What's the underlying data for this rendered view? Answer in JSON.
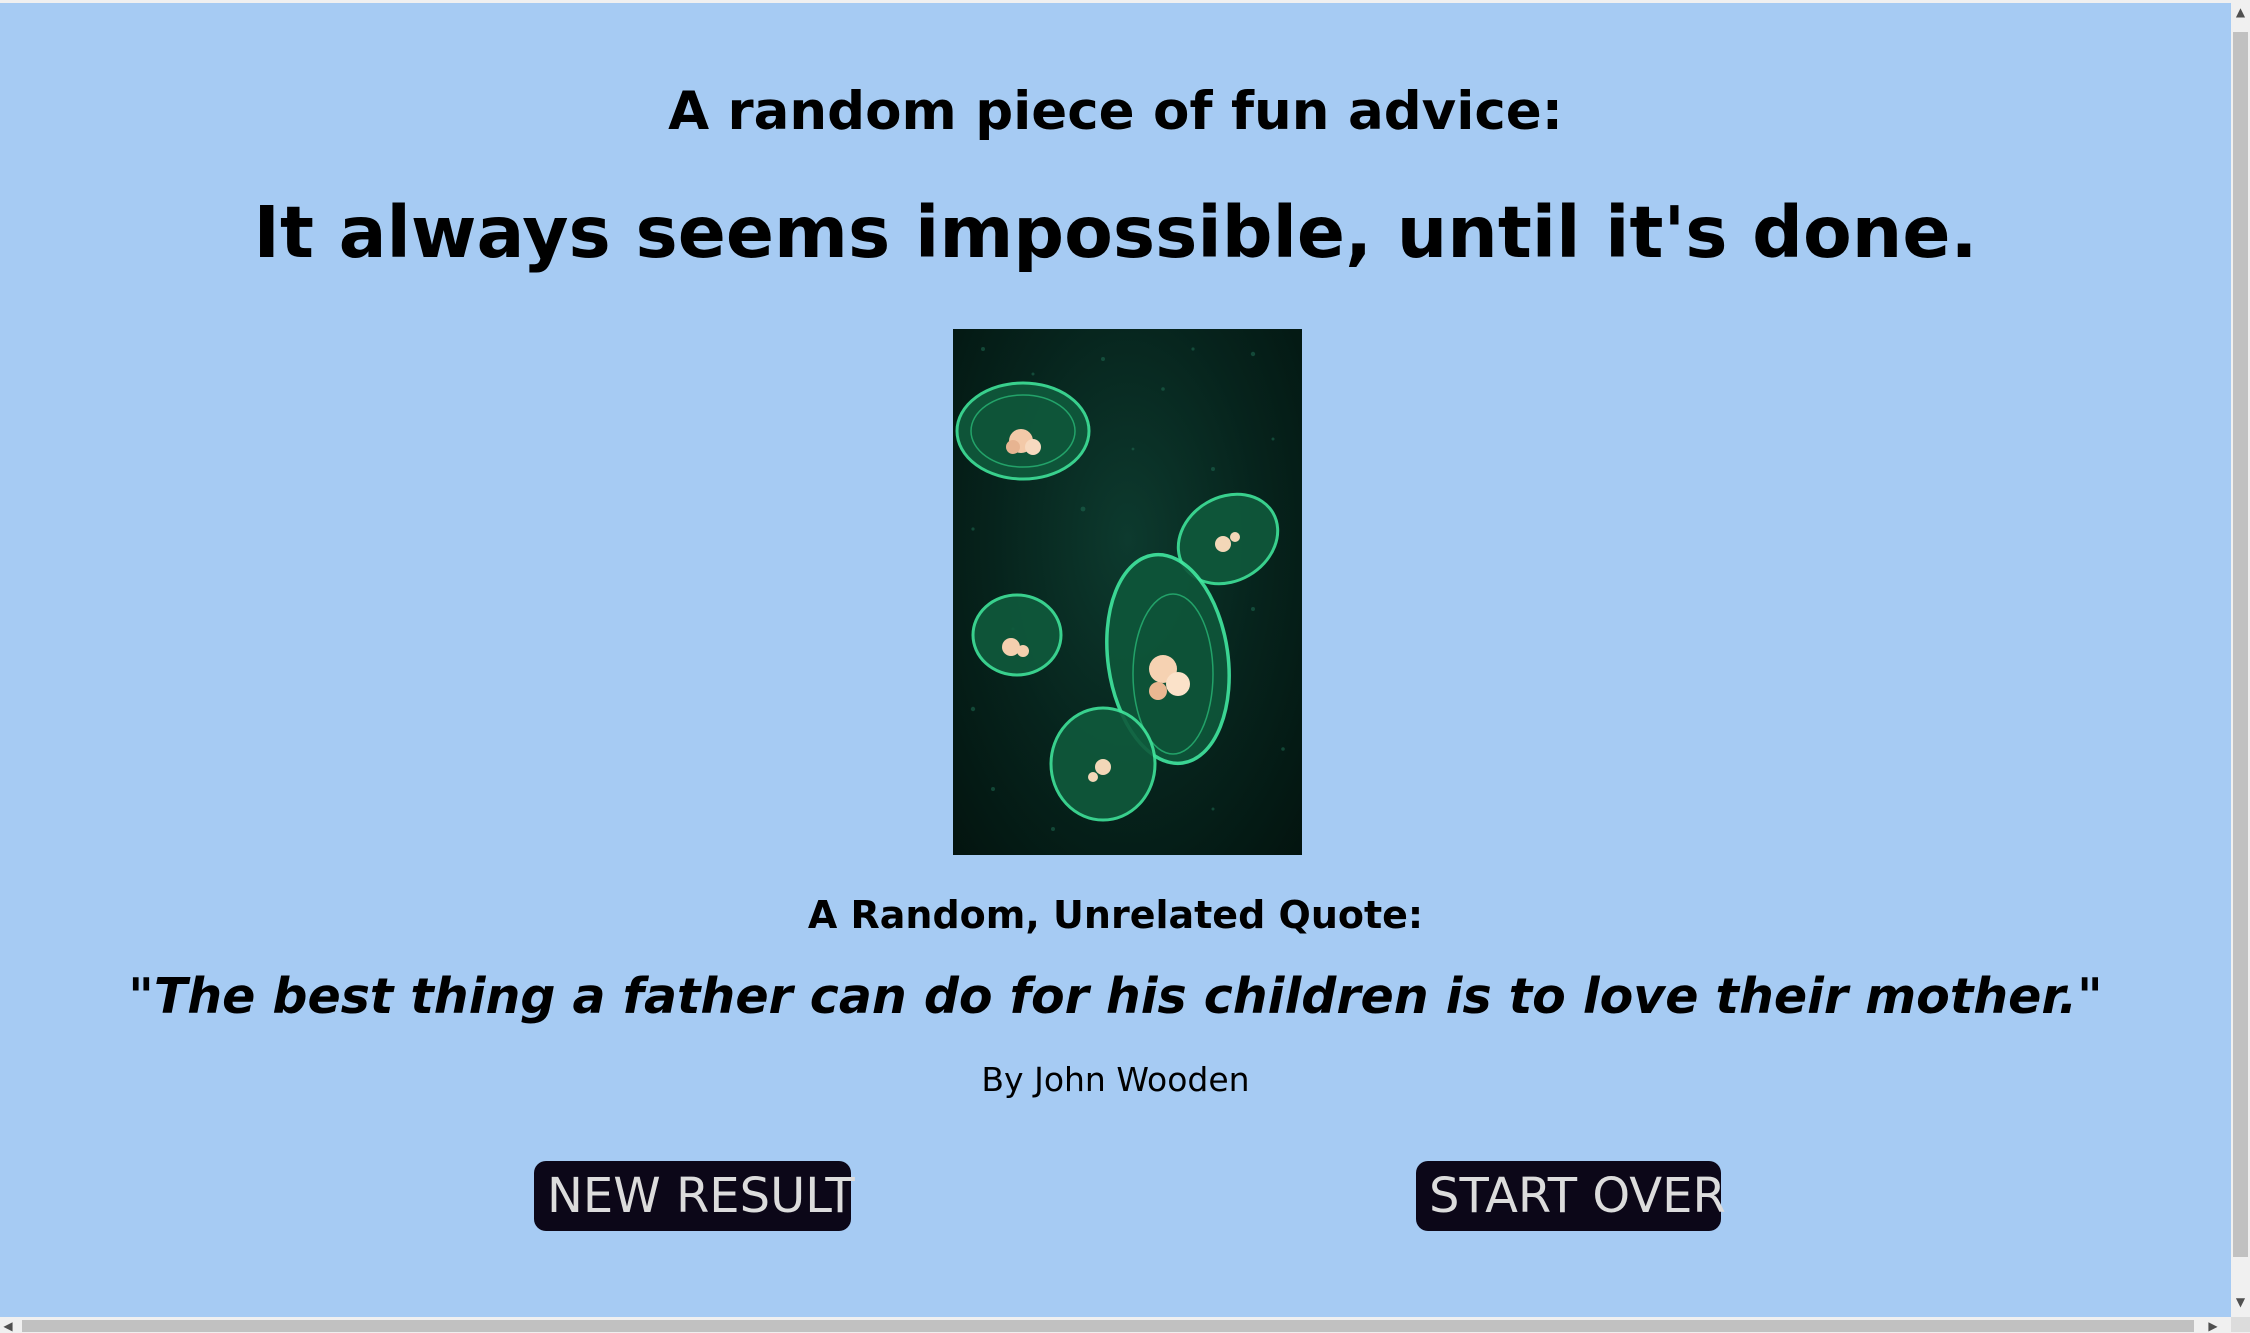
{
  "advice_label": "A random piece of fun advice:",
  "advice_text": "It always seems impossible, until it's done.",
  "image": {
    "subject": "jellyfish-photo"
  },
  "quote_label": "A Random, Unrelated Quote:",
  "quote_text": "\"The best thing a father can do for his children is to love their mother.\"",
  "quote_author": "By John Wooden",
  "buttons": {
    "new_result": "NEW RESULT",
    "start_over": "START OVER"
  },
  "colors": {
    "background": "#a6cbf3",
    "button_bg": "#0c0718",
    "button_text": "#dcdcdc"
  },
  "scrollbar": {
    "up_icon": "arrow-up-icon",
    "down_icon": "arrow-down-icon",
    "left_icon": "arrow-left-icon",
    "right_icon": "arrow-right-icon"
  }
}
